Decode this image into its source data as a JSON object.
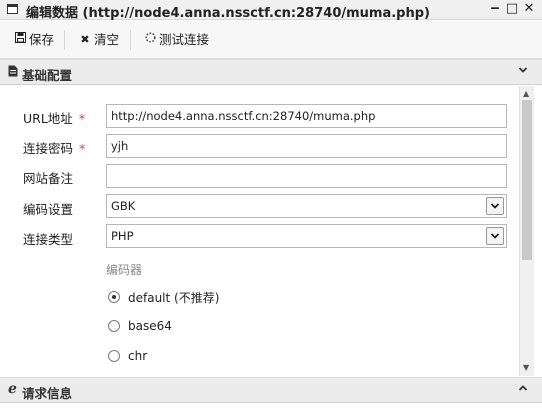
{
  "window": {
    "title": "编辑数据 (http://node4.anna.nssctf.cn:28740/muma.php)",
    "controls": {
      "minimize": "‒",
      "maximize": "□",
      "close": "✕"
    }
  },
  "toolbar": {
    "save_label": "保存",
    "clear_label": "清空",
    "test_label": "测试连接"
  },
  "panels": {
    "basic": {
      "title": "基础配置"
    },
    "request": {
      "title": "请求信息"
    }
  },
  "form": {
    "url": {
      "label": "URL地址",
      "required_mark": "*",
      "value": "http://node4.anna.nssctf.cn:28740/muma.php"
    },
    "password": {
      "label": "连接密码",
      "required_mark": "*",
      "value": "yjh"
    },
    "note": {
      "label": "网站备注",
      "value": ""
    },
    "encoding": {
      "label": "编码设置",
      "selected": "GBK"
    },
    "type": {
      "label": "连接类型",
      "selected": "PHP"
    }
  },
  "encoder": {
    "title": "编码器",
    "options": [
      {
        "label": "default (不推荐)",
        "checked": true
      },
      {
        "label": "base64",
        "checked": false
      },
      {
        "label": "chr",
        "checked": false
      }
    ]
  },
  "icons": {
    "window": "window-icon",
    "save": "floppy-icon",
    "clear": "x-icon",
    "test": "spinner-icon",
    "basic_panel": "document-icon",
    "request_panel": "e-icon"
  }
}
